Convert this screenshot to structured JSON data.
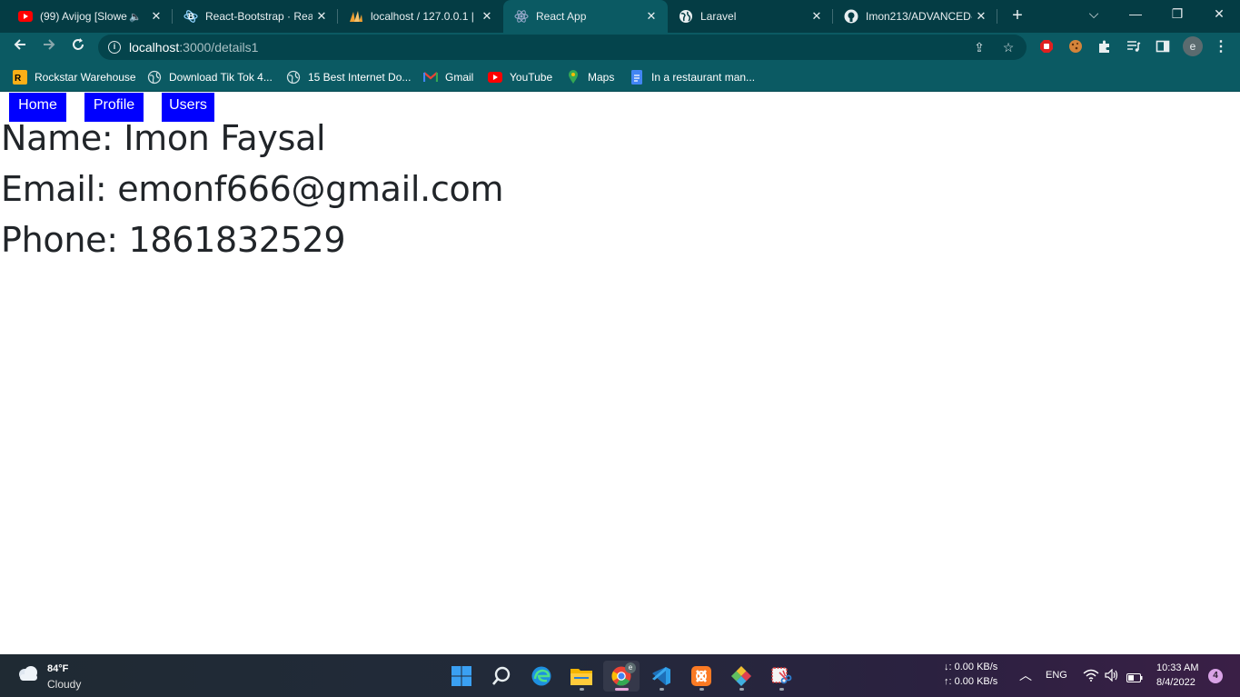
{
  "browser": {
    "tabs": [
      {
        "title": "(99) Avijog [Slowe",
        "icon": "youtube-icon",
        "audio": true,
        "active": false
      },
      {
        "title": "React-Bootstrap · Reac",
        "icon": "react-bootstrap-icon",
        "active": false
      },
      {
        "title": "localhost / 127.0.0.1 | p",
        "icon": "phpmyadmin-icon",
        "active": false
      },
      {
        "title": "React App",
        "icon": "react-icon",
        "active": true
      },
      {
        "title": "Laravel",
        "icon": "globe-icon",
        "active": false
      },
      {
        "title": "Imon213/ADVANCED-",
        "icon": "github-icon",
        "active": false
      }
    ],
    "address": {
      "host": "localhost",
      "path": ":3000/details1"
    },
    "profile_initial": "e",
    "bookmarks": [
      {
        "label": "Rockstar Warehouse",
        "icon": "rockstar-icon"
      },
      {
        "label": "Download Tik Tok 4...",
        "icon": "globe-icon"
      },
      {
        "label": "15 Best Internet Do...",
        "icon": "globe-icon"
      },
      {
        "label": "Gmail",
        "icon": "gmail-icon"
      },
      {
        "label": "YouTube",
        "icon": "youtube-icon"
      },
      {
        "label": "Maps",
        "icon": "maps-icon"
      },
      {
        "label": "In a restaurant man...",
        "icon": "docs-icon"
      }
    ]
  },
  "page": {
    "nav": {
      "home": "Home",
      "profile": "Profile",
      "users": "Users"
    },
    "user": {
      "name": "Name: Imon Faysal",
      "email": "Email: emonf666@gmail.com",
      "phone": "Phone: 1861832529"
    }
  },
  "taskbar": {
    "weather": {
      "temp": "84°F",
      "condition": "Cloudy"
    },
    "network": {
      "down": "↓: 0.00 KB/s",
      "up": "↑: 0.00 KB/s"
    },
    "language": "ENG",
    "clock": {
      "time": "10:33 AM",
      "date": "8/4/2022"
    },
    "notifications": "4"
  },
  "colors": {
    "chrome_dark": "#043c44",
    "chrome_toolbar": "#0b5a63",
    "nav_button_bg": "#0000ff",
    "text_dark": "#212529"
  }
}
